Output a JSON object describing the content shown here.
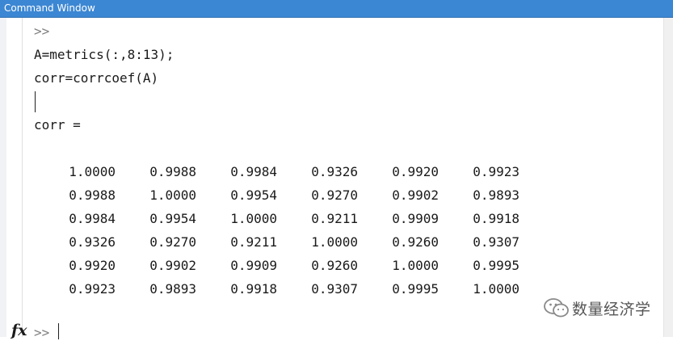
{
  "window": {
    "title": "Command Window"
  },
  "commands": {
    "prompt1": ">>",
    "line1": "A=metrics(:,8:13);",
    "line2": "corr=corrcoef(A)",
    "output_label": "corr ="
  },
  "matrix": {
    "rows": [
      [
        "1.0000",
        "0.9988",
        "0.9984",
        "0.9326",
        "0.9920",
        "0.9923"
      ],
      [
        "0.9988",
        "1.0000",
        "0.9954",
        "0.9270",
        "0.9902",
        "0.9893"
      ],
      [
        "0.9984",
        "0.9954",
        "1.0000",
        "0.9211",
        "0.9909",
        "0.9918"
      ],
      [
        "0.9326",
        "0.9270",
        "0.9211",
        "1.0000",
        "0.9260",
        "0.9307"
      ],
      [
        "0.9920",
        "0.9902",
        "0.9909",
        "0.9260",
        "1.0000",
        "0.9995"
      ],
      [
        "0.9923",
        "0.9893",
        "0.9918",
        "0.9307",
        "0.9995",
        "1.0000"
      ]
    ]
  },
  "bottom": {
    "fx_label": "fx",
    "prompt": ">>"
  },
  "watermark": {
    "text": "数量经济学"
  },
  "colors": {
    "titlebar": "#3c87d3",
    "prompt": "#808080",
    "text": "#1a1a1a"
  }
}
